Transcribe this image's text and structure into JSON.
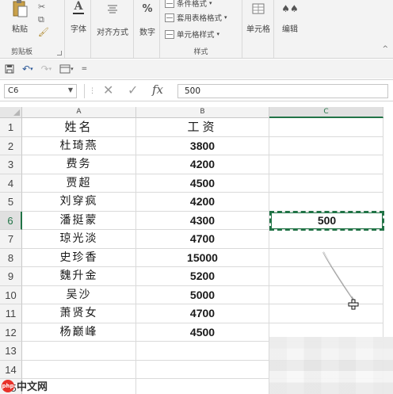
{
  "ribbon": {
    "clipboard": {
      "paste_label": "粘贴",
      "group_label": "剪贴板"
    },
    "font": {
      "label": "字体"
    },
    "alignment": {
      "label": "对齐方式"
    },
    "number": {
      "label": "数字",
      "icon_text": "%"
    },
    "styles": {
      "conditional_format": "条件格式",
      "table_format": "套用表格格式",
      "cell_styles": "单元格样式",
      "group_label": "样式"
    },
    "cells": {
      "label": "单元格"
    },
    "editing": {
      "label": "编辑"
    }
  },
  "formula_bar": {
    "name_box": "C6",
    "fx_label": "fx",
    "value": "500"
  },
  "columns": [
    "A",
    "B",
    "C"
  ],
  "rows": [
    {
      "num": "1",
      "a": "姓名",
      "b": "工资",
      "c": ""
    },
    {
      "num": "2",
      "a": "杜琦燕",
      "b": "3800",
      "c": ""
    },
    {
      "num": "3",
      "a": "费务",
      "b": "4200",
      "c": ""
    },
    {
      "num": "4",
      "a": "贾超",
      "b": "4500",
      "c": ""
    },
    {
      "num": "5",
      "a": "刘穿疯",
      "b": "4200",
      "c": ""
    },
    {
      "num": "6",
      "a": "潘挺蒙",
      "b": "4300",
      "c": "500"
    },
    {
      "num": "7",
      "a": "琼光淡",
      "b": "4700",
      "c": ""
    },
    {
      "num": "8",
      "a": "史珍香",
      "b": "15000",
      "c": ""
    },
    {
      "num": "9",
      "a": "魏升金",
      "b": "5200",
      "c": ""
    },
    {
      "num": "10",
      "a": "吴沙",
      "b": "5000",
      "c": ""
    },
    {
      "num": "11",
      "a": "萧贤女",
      "b": "4700",
      "c": ""
    },
    {
      "num": "12",
      "a": "杨巅峰",
      "b": "4500",
      "c": ""
    },
    {
      "num": "13",
      "a": "",
      "b": "",
      "c": ""
    },
    {
      "num": "14",
      "a": "",
      "b": "",
      "c": ""
    },
    {
      "num": "15",
      "a": "",
      "b": "",
      "c": ""
    }
  ],
  "selected_cell": "C6",
  "accent_color": "#217346",
  "watermark": {
    "logo_text": "php",
    "text": "中文网"
  }
}
